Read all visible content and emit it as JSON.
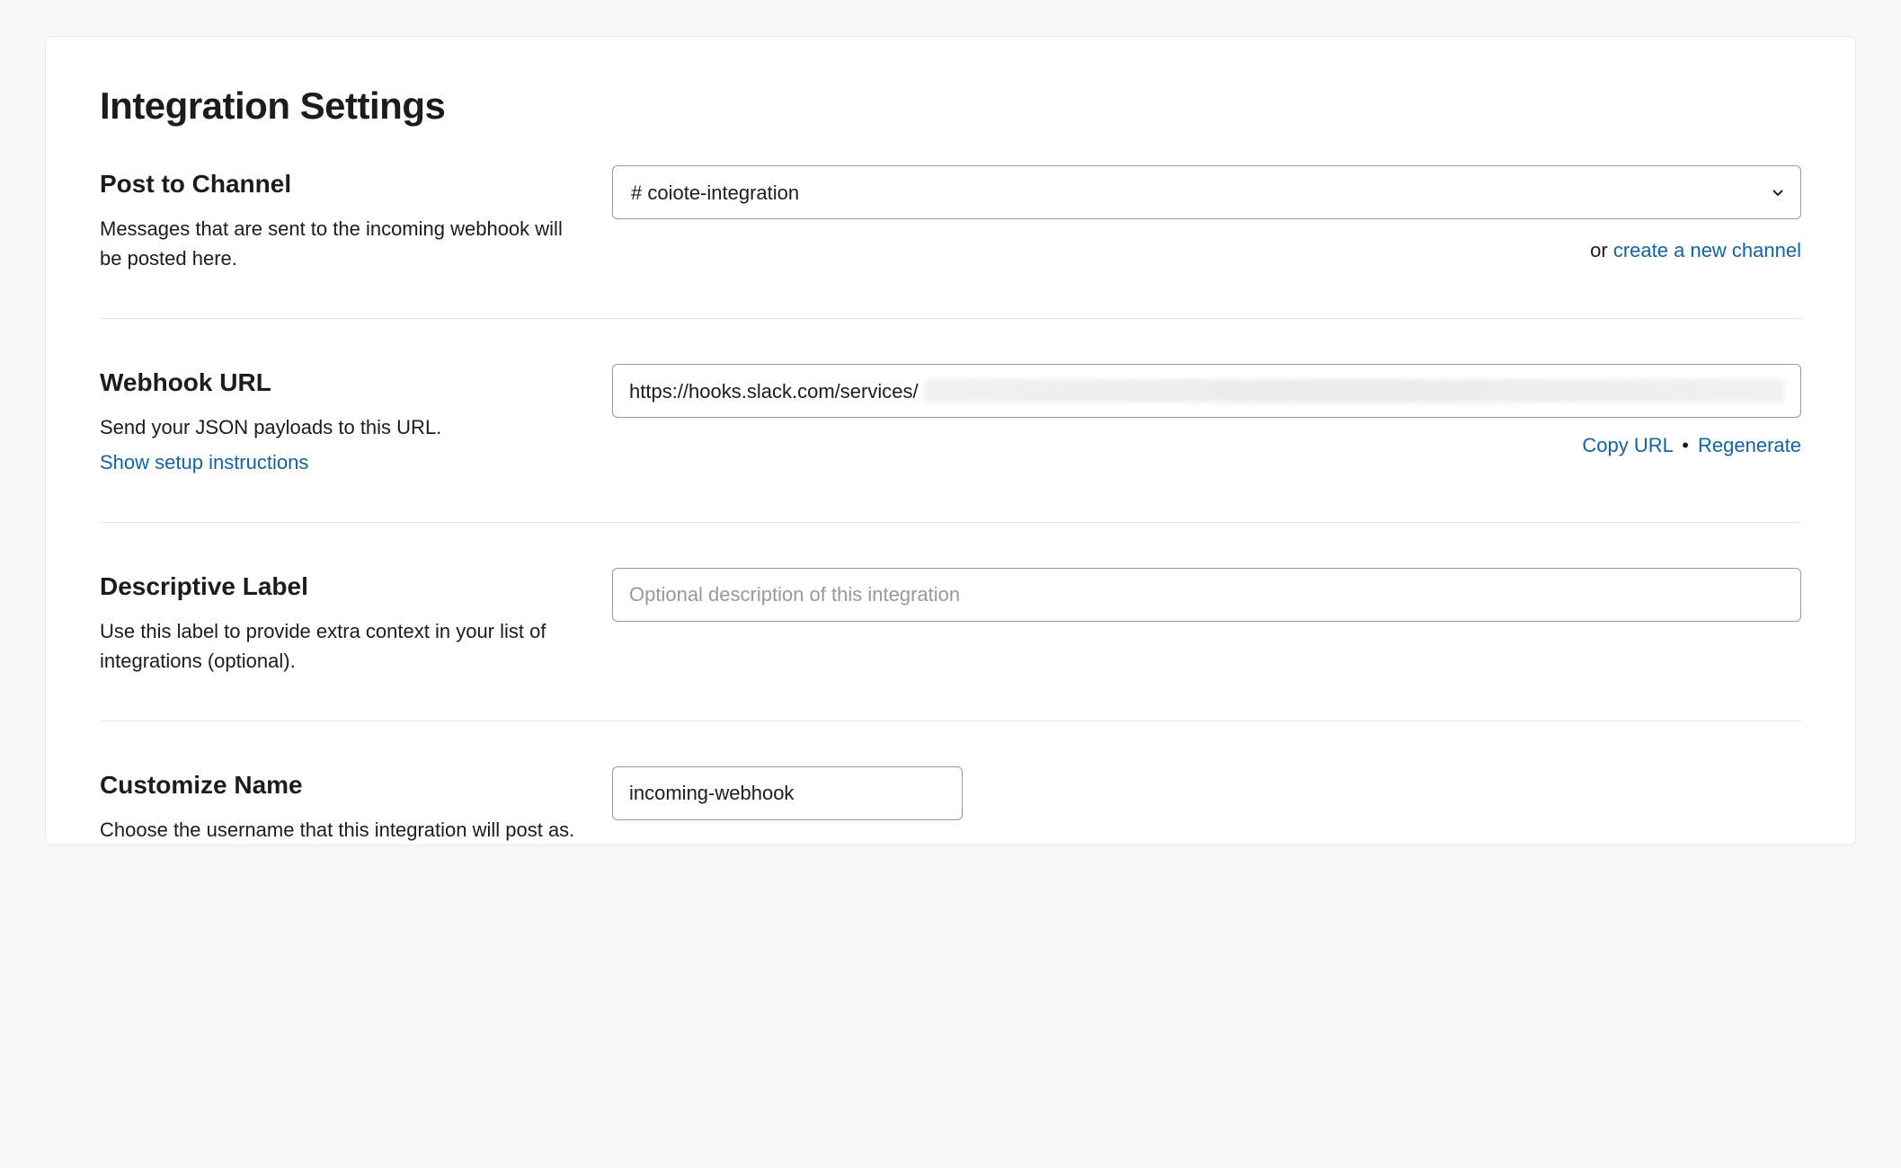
{
  "page_title": "Integration Settings",
  "post_to_channel": {
    "title": "Post to Channel",
    "description": "Messages that are sent to the incoming webhook will be posted here.",
    "selected_channel": "# coiote-integration",
    "or_text": "or ",
    "create_link": "create a new channel"
  },
  "webhook_url": {
    "title": "Webhook URL",
    "description": "Send your JSON payloads to this URL.",
    "show_instructions": "Show setup instructions",
    "url_visible_part": "https://hooks.slack.com/services/",
    "copy_label": "Copy URL",
    "regenerate_label": "Regenerate"
  },
  "descriptive_label": {
    "title": "Descriptive Label",
    "description": "Use this label to provide extra context in your list of integrations (optional).",
    "placeholder": "Optional description of this integration"
  },
  "customize_name": {
    "title": "Customize Name",
    "description": "Choose the username that this integration will post as.",
    "value": "incoming-webhook"
  }
}
